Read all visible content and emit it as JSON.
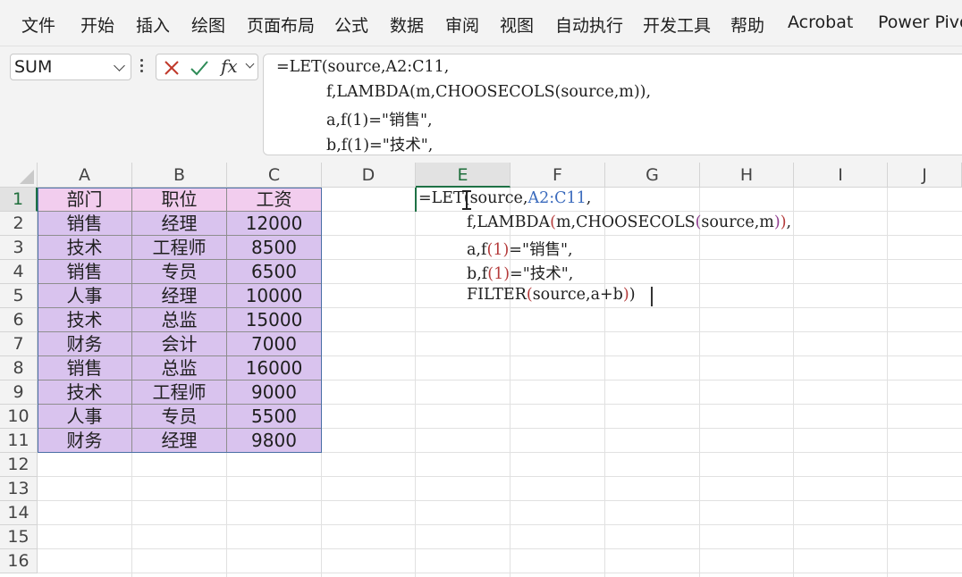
{
  "ribbon": {
    "tabs": [
      "文件",
      "开始",
      "插入",
      "绘图",
      "页面布局",
      "公式",
      "数据",
      "审阅",
      "视图",
      "自动执行",
      "开发工具",
      "帮助",
      "Acrobat",
      "Power Pivot"
    ]
  },
  "formula_bar": {
    "name_box": "SUM",
    "fx_label": "fx",
    "lines": [
      "=LET(source,A2:C11,",
      "f,LAMBDA(m,CHOOSECOLS(source,m)),",
      "a,f(1)=\"销售\",",
      "b,f(1)=\"技术\","
    ]
  },
  "sheet": {
    "columns": [
      "A",
      "B",
      "C",
      "D",
      "E",
      "F",
      "G",
      "H",
      "I",
      "J"
    ],
    "rows": [
      "1",
      "2",
      "3",
      "4",
      "5",
      "6",
      "7",
      "8",
      "9",
      "10",
      "11",
      "12",
      "13",
      "14",
      "15",
      "16"
    ],
    "table": {
      "headers": [
        "部门",
        "职位",
        "工资"
      ],
      "rows": [
        [
          "销售",
          "经理",
          "12000"
        ],
        [
          "技术",
          "工程师",
          "8500"
        ],
        [
          "销售",
          "专员",
          "6500"
        ],
        [
          "人事",
          "经理",
          "10000"
        ],
        [
          "技术",
          "总监",
          "15000"
        ],
        [
          "财务",
          "会计",
          "7000"
        ],
        [
          "销售",
          "总监",
          "16000"
        ],
        [
          "技术",
          "工程师",
          "9000"
        ],
        [
          "人事",
          "专员",
          "5500"
        ],
        [
          "财务",
          "经理",
          "9800"
        ]
      ]
    },
    "active_cell": "E1",
    "edit_text": {
      "line1_prefix": "=LET(",
      "line1_a": "source,",
      "line1_ref": "A2:C11",
      "line1_end": ",",
      "line2_a": "f,LAMBDA",
      "line2_p1": "(",
      "line2_b": "m,CHOOSECOLS",
      "line2_p2": "(",
      "line2_c": "source,m",
      "line2_p3": ")",
      "line2_p4": ")",
      "line2_end": ",",
      "line3_a": "a,f",
      "line3_p": "(1)",
      "line3_b": "=\"销售\",",
      "line4_a": "b,f",
      "line4_p": "(1)",
      "line4_b": "=\"技术\",",
      "line5_a": "FILTER",
      "line5_p1": "(",
      "line5_b": "source,a+b",
      "line5_p2": ")",
      "line5_c": ")"
    }
  },
  "colors": {
    "header_fill": "#f2cdee",
    "body_fill": "#d9c3ee",
    "reference_blue": "#3b6bbd",
    "selection_green": "#1e7145"
  }
}
